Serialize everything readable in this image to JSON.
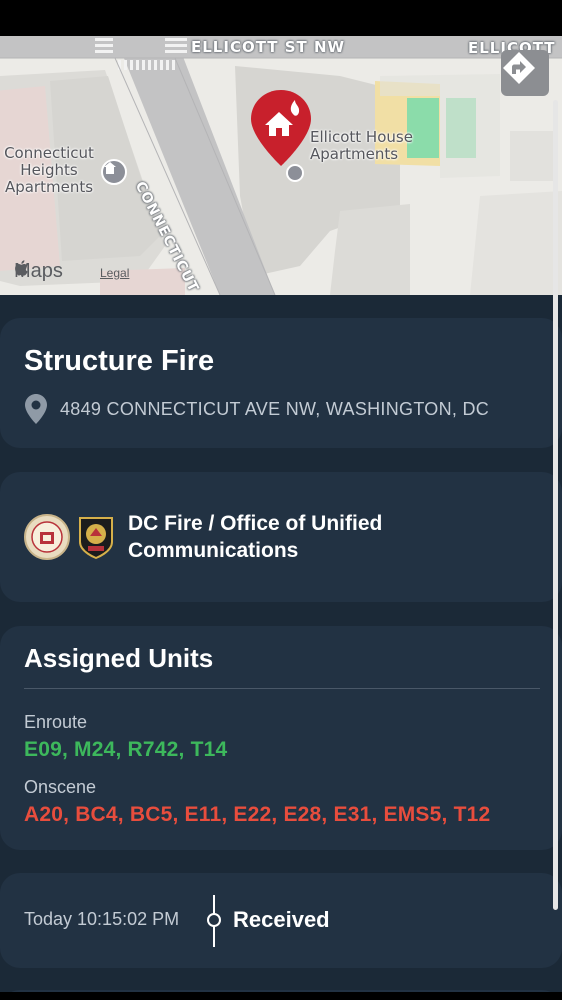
{
  "map": {
    "street_top": "ELLICOTT ST NW",
    "street_top_right": "ELLICOTT",
    "street_connecticut": "CONNECTICUT AVE",
    "poi_left": "Connecticut Heights Apartments",
    "poi_right": "Ellicott House Apartments",
    "maps_logo": "Maps",
    "maps_legal": "Legal",
    "icons": {
      "directions": "directions-arrow-icon",
      "incident_pin": "house-fire-pin-icon",
      "poi": "building-icon"
    }
  },
  "incident": {
    "title": "Structure Fire",
    "address": "4849 CONNECTICUT AVE NW, WASHINGTON, DC",
    "location_icon": "location-pin-icon"
  },
  "agency": {
    "name": "DC Fire / Office of Unified Communications"
  },
  "units": {
    "section_title": "Assigned Units",
    "enroute_label": "Enroute",
    "enroute_units": "E09, M24, R742, T14",
    "onscene_label": "Onscene",
    "onscene_units": "A20, BC4, BC5, E11, E22, E28, E31, EMS5, T12"
  },
  "timeline": {
    "time": "Today 10:15:02 PM",
    "event": "Received"
  },
  "colors": {
    "background": "#1b2937",
    "card": "#223243",
    "enroute": "#3db85c",
    "onscene": "#e84d3d",
    "pin": "#c8202c"
  }
}
